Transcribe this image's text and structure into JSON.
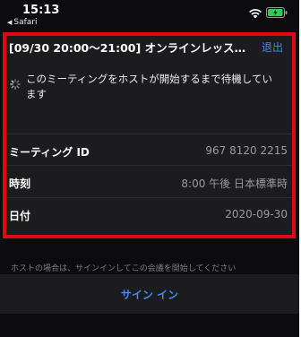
{
  "status_bar": {
    "time": "15:13",
    "back_app": "Safari",
    "icons": [
      "wifi-icon",
      "battery-icon"
    ],
    "battery_color": "#34c759"
  },
  "meeting": {
    "title": "[09/30 20:00〜21:00] オンラインレッスン…",
    "leave_label": "退出",
    "waiting_message": "このミーティングをホストが開始するまで待機しています",
    "details": [
      {
        "label": "ミーティング ID",
        "value": "967 8120 2215"
      },
      {
        "label": "時刻",
        "value": "8:00 午後 日本標準時"
      },
      {
        "label": "日付",
        "value": "2020-09-30"
      }
    ]
  },
  "footer": {
    "host_note": "ホストの場合は、サインインしてこの会議を開始してください",
    "signin_label": "サイン イン"
  },
  "colors": {
    "accent": "#3d8cf2",
    "highlight": "#e30613",
    "background": "#0c0c0e",
    "card": "#1c1c1e"
  }
}
